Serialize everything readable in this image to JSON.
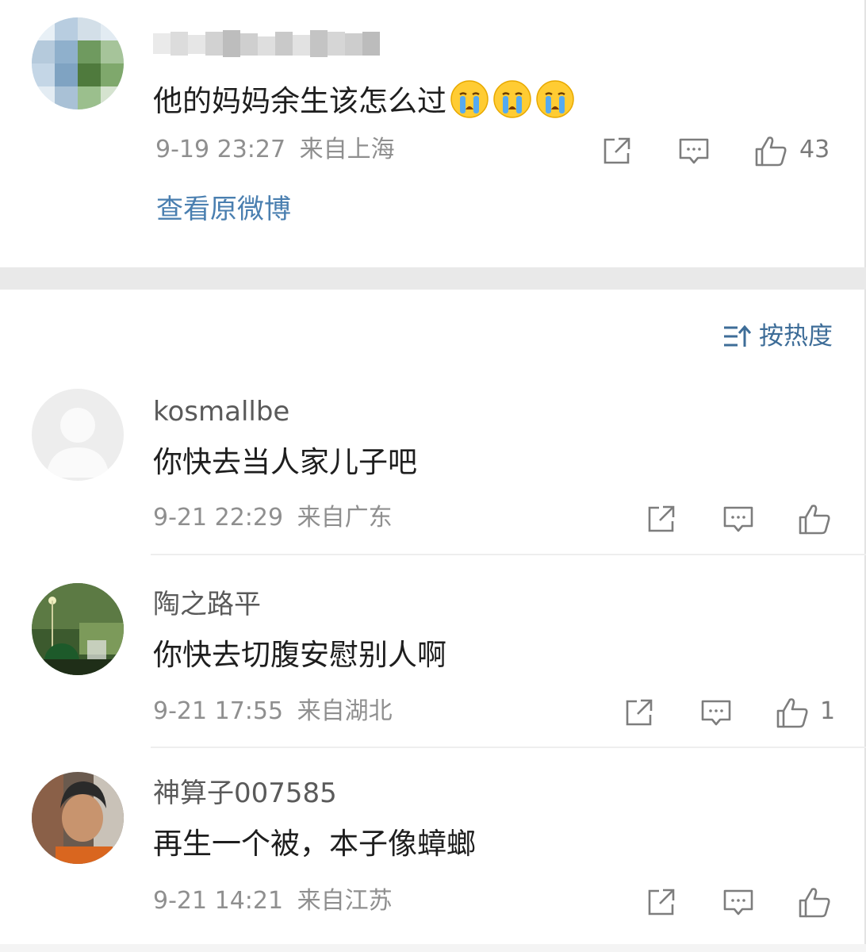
{
  "post": {
    "username": "",
    "text": "他的妈妈余生该怎么过",
    "emoji": [
      "crying-face",
      "crying-face",
      "crying-face"
    ],
    "time": "9-19 23:27",
    "location": "来自上海",
    "likes": "43",
    "view_original": "查看原微博"
  },
  "sort": {
    "label": "按热度"
  },
  "comments": [
    {
      "name": "kosmallbe",
      "text": "你快去当人家儿子吧",
      "time": "9-21 22:29",
      "location": "来自广东",
      "likes": ""
    },
    {
      "name": "陶之路平",
      "text": "你快去切腹安慰别人啊",
      "time": "9-21 17:55",
      "location": "来自湖北",
      "likes": "1"
    },
    {
      "name": "神算子007585",
      "text": "再生一个被，本子像蟑螂",
      "time": "9-21 14:21",
      "location": "来自江苏",
      "likes": ""
    }
  ],
  "icons": [
    "share-icon",
    "comment-icon",
    "like-icon",
    "sort-icon"
  ],
  "colors": {
    "link": "#4a7fb0",
    "sort": "#3e6d98",
    "separator": "#e9e9e9"
  }
}
